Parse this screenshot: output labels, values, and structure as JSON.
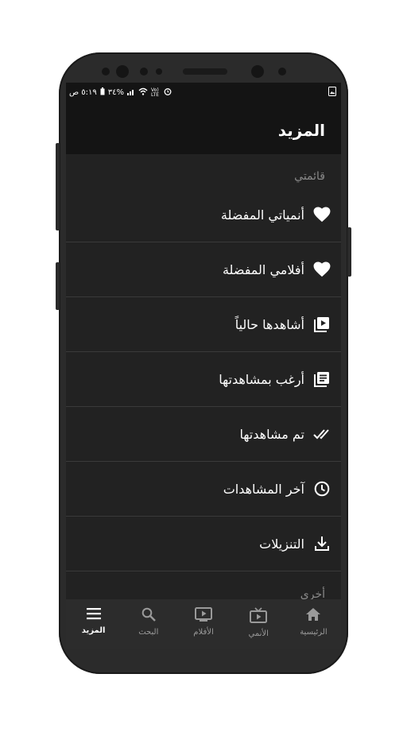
{
  "status_bar": {
    "time": "٥:١٩ ص",
    "battery": "٣٤%",
    "network": "Vo) LTE"
  },
  "app_bar": {
    "title": "المزيد"
  },
  "section": {
    "title": "قائمتي"
  },
  "menu": [
    {
      "label": "أنمياتي المفضلة",
      "icon": "heart-icon"
    },
    {
      "label": "أفلامي المفضلة",
      "icon": "heart-icon"
    },
    {
      "label": "أشاهدها حالياً",
      "icon": "video-library-icon"
    },
    {
      "label": "أرغب بمشاهدتها",
      "icon": "list-icon"
    },
    {
      "label": "تم مشاهدتها",
      "icon": "double-check-icon"
    },
    {
      "label": "آخر المشاهدات",
      "icon": "clock-icon"
    },
    {
      "label": "التنزيلات",
      "icon": "download-icon"
    }
  ],
  "section2": {
    "title": "أخرى"
  },
  "bottom_nav": [
    {
      "label": "المزيد",
      "icon": "menu-icon",
      "active": true
    },
    {
      "label": "البحث",
      "icon": "search-icon"
    },
    {
      "label": "الأفلام",
      "icon": "movie-icon"
    },
    {
      "label": "الأنمي",
      "icon": "tv-icon"
    },
    {
      "label": "الرئيسية",
      "icon": "home-icon"
    }
  ],
  "colors": {
    "background": "#222222",
    "app_bar": "#141414",
    "text": "#ffffff",
    "muted": "#8a8a8a"
  }
}
